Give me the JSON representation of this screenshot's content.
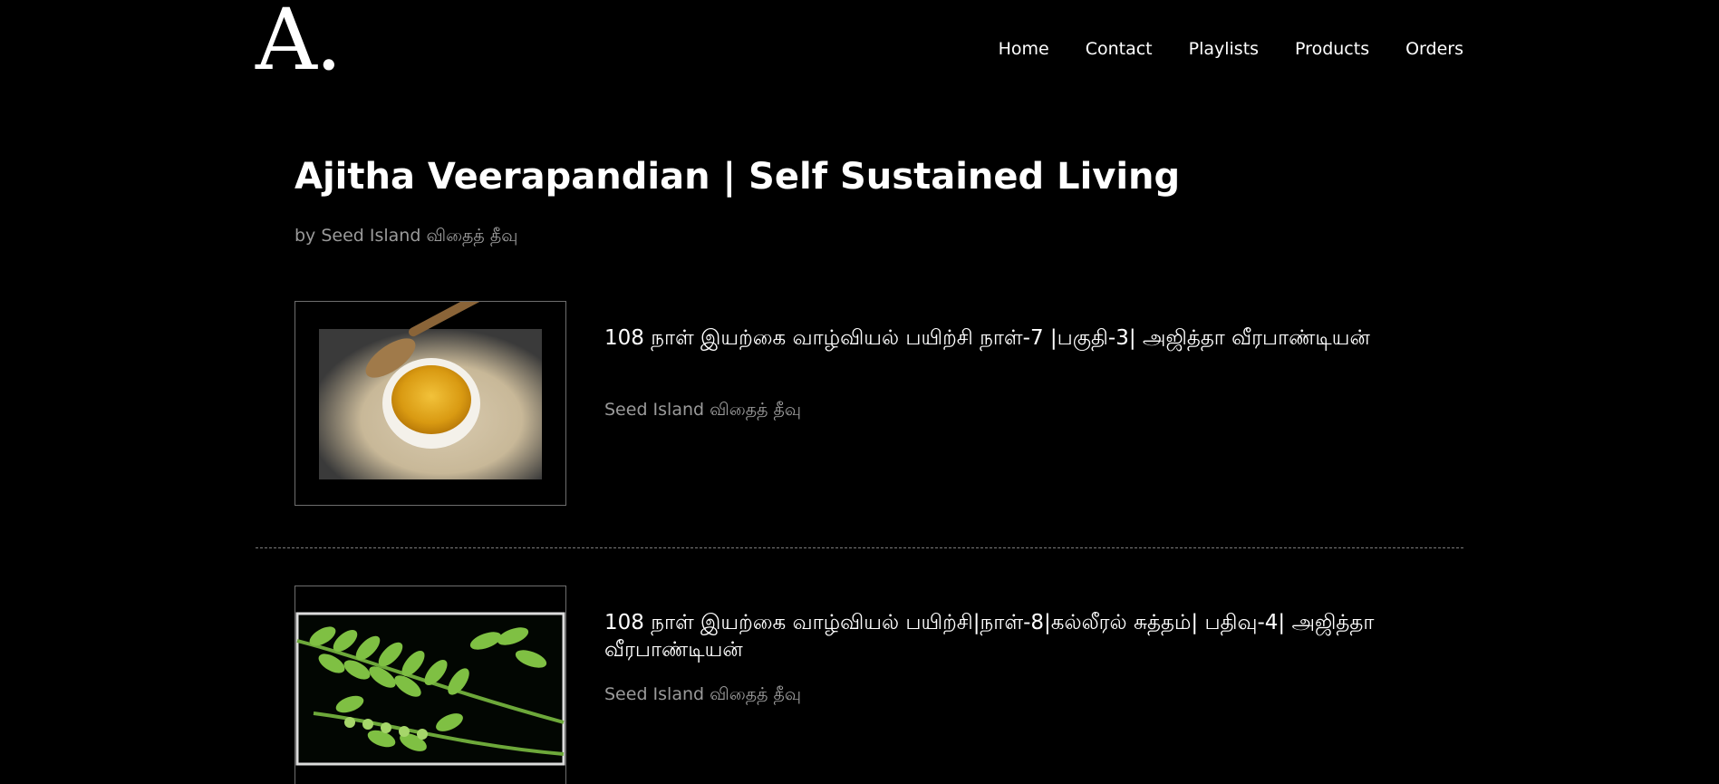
{
  "logo": {
    "text": "A."
  },
  "nav": {
    "items": [
      {
        "label": "Home"
      },
      {
        "label": "Contact"
      },
      {
        "label": "Playlists"
      },
      {
        "label": "Products"
      },
      {
        "label": "Orders"
      }
    ]
  },
  "playlist": {
    "title": "Ajitha Veerapandian | Self Sustained Living",
    "author": "by Seed Island விதைத் தீவு"
  },
  "videos": [
    {
      "title": "108 நாள் இயற்கை வாழ்வியல் பயிற்சி நாள்-7 |பகுதி-3| அஜித்தா வீரபாண்டியன்",
      "channel": "Seed Island விதைத் தீவு"
    },
    {
      "title": "108 நாள் இயற்கை வாழ்வியல் பயிற்சி|நாள்-8|கல்லீரல் சுத்தம்| பதிவு-4| அஜித்தா வீரபாண்டியன்",
      "channel": "Seed Island விதைத் தீவு"
    }
  ],
  "colors": {
    "background": "#000000",
    "text": "#ffffff",
    "muted": "#9a9a9a"
  }
}
